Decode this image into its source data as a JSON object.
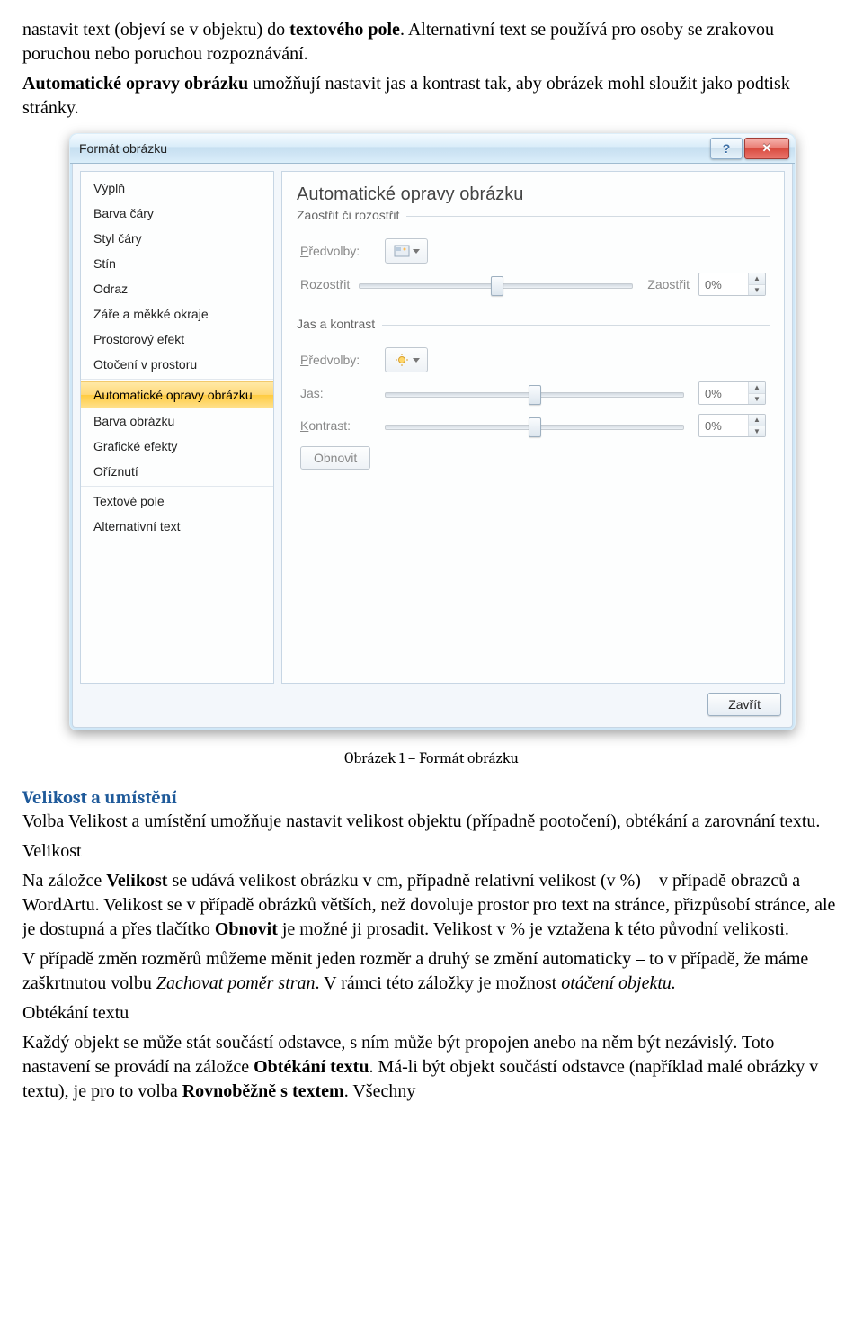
{
  "intro": {
    "p1a": "nastavit text (objeví se v objektu) do ",
    "p1b": "textového pole",
    "p1c": ". Alternativní text se používá pro osoby se zrakovou poruchou nebo poruchou rozpoznávání.",
    "p2a": "Automatické opravy obrázku",
    "p2b": " umožňují nastavit jas a kontrast tak, aby obrázek mohl sloužit jako podtisk stránky."
  },
  "dialog": {
    "title": "Formát obrázku",
    "categories": [
      "Výplň",
      "Barva čáry",
      "Styl čáry",
      "Stín",
      "Odraz",
      "Záře a měkké okraje",
      "Prostorový efekt",
      "Otočení v prostoru",
      "Automatické opravy obrázku",
      "Barva obrázku",
      "Grafické efekty",
      "Oříznutí",
      "Textové pole",
      "Alternativní text"
    ],
    "panel_title": "Automatické opravy obrázku",
    "group1": "Zaostřit či rozostřit",
    "group2": "Jas a kontrast",
    "presets_label_a": "P",
    "presets_label_b": "ředvolby:",
    "soften": "Rozostřit",
    "sharpen": "Zaostřit",
    "sharpen_val": "0%",
    "bright_a": "J",
    "bright_b": "as:",
    "bright_val": "0%",
    "contrast_a": "K",
    "contrast_b": "ontrast:",
    "contrast_val": "0%",
    "reset_a": "O",
    "reset_b": "bnovit",
    "close": "Zavřít"
  },
  "caption": "Obrázek 1 – Formát obrázku",
  "sec": {
    "h": "Velikost a umístění",
    "p1": "Volba Velikost a umístění umožňuje nastavit velikost objektu (případně pootočení), obtékání a zarovnání textu.",
    "p1b": "Velikost",
    "p2a": "Na záložce ",
    "p2b": "Velikost",
    "p2c": " se udává velikost obrázku v cm, případně relativní velikost (v %) – v případě obrazců a WordArtu. Velikost se v případě obrázků větších, než dovoluje prostor pro text na stránce, přizpůsobí stránce, ale je dostupná a přes tlačítko ",
    "p2d": "Obnovit",
    "p2e": " je možné ji prosadit. Velikost v % je vztažena k této původní velikosti.",
    "p3a": "V případě změn rozměrů můžeme měnit jeden rozměr a druhý se změní automaticky – to v případě, že máme zaškrtnutou volbu ",
    "p3b": "Zachovat poměr stran",
    "p3c": ". V rámci této záložky je možnost ",
    "p3d": "otáčení objektu.",
    "p4": "Obtékání textu",
    "p5a": "Každý objekt se může stát součástí odstavce, s ním může být propojen anebo na něm být nezávislý. Toto nastavení se provádí na záložce ",
    "p5b": "Obtékání textu",
    "p5c": ". Má-li být objekt součástí odstavce (například malé obrázky v textu), je pro to volba ",
    "p5d": "Rovnoběžně s textem",
    "p5e": ". Všechny"
  }
}
